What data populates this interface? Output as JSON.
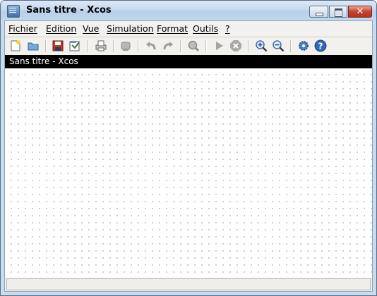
{
  "window": {
    "title": "Sans titre - Xcos"
  },
  "window_controls": {
    "minimize": "minimize-icon",
    "maximize": "maximize-icon",
    "close": "close-icon",
    "close_glyph": "✕"
  },
  "menu": [
    {
      "label": "Fichier"
    },
    {
      "label": "Edition"
    },
    {
      "label": "Vue"
    },
    {
      "label": "Simulation"
    },
    {
      "label": "Format"
    },
    {
      "label": "Outils"
    },
    {
      "label": "?"
    }
  ],
  "toolbar": {
    "icons": [
      "new-diagram-icon",
      "open-icon",
      "save-icon",
      "save-as-icon",
      "print-icon",
      "delete-icon",
      "undo-icon",
      "redo-icon",
      "fit-diagram-icon",
      "start-icon",
      "stop-icon",
      "zoom-in-icon",
      "zoom-out-icon",
      "setup-icon",
      "help-icon"
    ]
  },
  "document": {
    "tab_title": "Sans titre - Xcos"
  },
  "colors": {
    "titlebar": "#c5d9ee",
    "tab_bg": "#000000",
    "canvas_bg": "#ffffff",
    "grid_dot": "#b5b5b5",
    "close_red": "#c6442b"
  }
}
